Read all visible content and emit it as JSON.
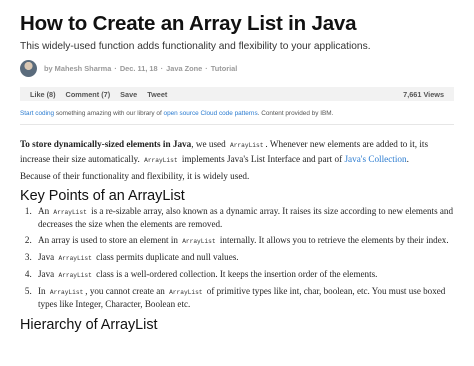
{
  "article": {
    "title": "How to Create an Array List in Java",
    "subtitle": "This widely-used function adds functionality and flexibility to your applications."
  },
  "byline": {
    "author": "by Mahesh Sharma",
    "sep": "·",
    "date": "Dec. 11, 18",
    "zone": "Java Zone",
    "type": "Tutorial"
  },
  "actions": {
    "like": "Like (8)",
    "comment": "Comment (7)",
    "save": "Save",
    "tweet": "Tweet",
    "views": "7,661 Views"
  },
  "promo": {
    "link1": "Start coding",
    "text1": " something amazing with our library of ",
    "link2": "open source Cloud code patterns",
    "text2": ". Content provided by IBM."
  },
  "intro": {
    "p1_bold": "To store dynamically-sized elements in Java",
    "p1_a": ", we used ",
    "p1_code1": "ArrayList",
    "p1_b": ". Whenever new elements are added to it, its increase their size automatically. ",
    "p1_code2": "ArrayList",
    "p1_c": " implements Java's List Interface and part of ",
    "p1_link": "Java's Collection",
    "p1_d": ".",
    "p2": "Because of their functionality and flexibility, it is widely used."
  },
  "key_points": {
    "heading": "Key Points of an ArrayList",
    "items": [
      {
        "pre": "An ",
        "code": "ArrayList",
        "post": " is a re-sizable array, also known as a dynamic array. It raises its size according to new elements and decreases the size when the elements are removed."
      },
      {
        "pre": "An array is used to store an element in ",
        "code": "ArrayList",
        "post": " internally. It allows you to retrieve the elements by their index."
      },
      {
        "pre": "Java ",
        "code": "ArrayList",
        "post": " class permits duplicate and null values."
      },
      {
        "pre": "Java ",
        "code": "ArrayList",
        "post": " class is a well-ordered collection. It keeps the insertion order of the elements."
      },
      {
        "pre": "In ",
        "code": "ArrayList",
        "post": ", you cannot create an ",
        "code2": "ArrayList",
        "post2": " of primitive types like int, char, boolean, etc. You must use boxed types like Integer, Character, Boolean etc."
      }
    ]
  },
  "hierarchy": {
    "heading": "Hierarchy of ArrayList"
  }
}
